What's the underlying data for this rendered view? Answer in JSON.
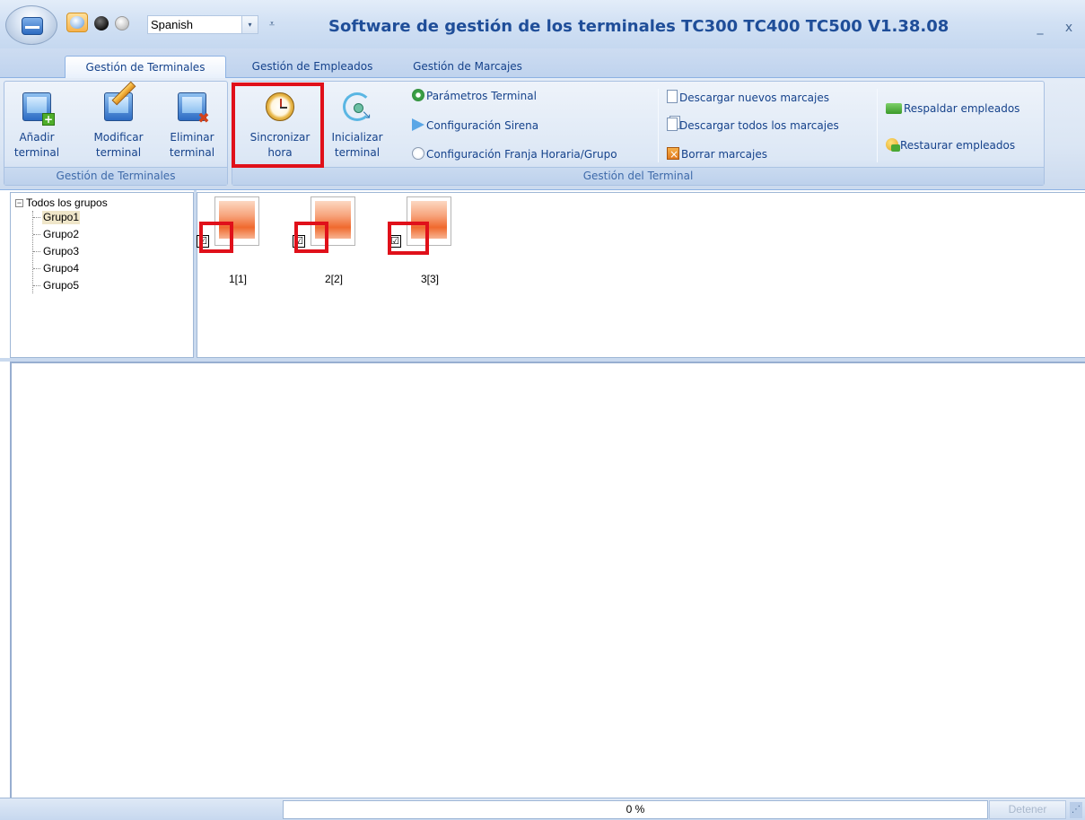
{
  "window": {
    "title": "Software de gestión de los terminales TC300 TC400 TC500 V1.38.08",
    "minimize_label": "_",
    "close_label": "x"
  },
  "quick_access": {
    "language": "Spanish",
    "dropdown_icon": "chevron-down-icon",
    "customize_icon": "customize-toolbar-icon"
  },
  "tabs": [
    {
      "label": "Gestión de Terminales",
      "active": true
    },
    {
      "label": "Gestión de Empleados",
      "active": false
    },
    {
      "label": "Gestión de Marcajes",
      "active": false
    }
  ],
  "ribbon": {
    "group_terminales": {
      "caption": "Gestión de Terminales",
      "buttons": [
        {
          "label": "Añadir\nterminal",
          "icon": "add-terminal-icon"
        },
        {
          "label": "Modificar\nterminal",
          "icon": "edit-terminal-icon"
        },
        {
          "label": "Eliminar\nterminal",
          "icon": "delete-terminal-icon"
        }
      ]
    },
    "group_terminal": {
      "caption": "Gestión del Terminal",
      "big_buttons": [
        {
          "label": "Sincronizar\nhora",
          "icon": "clock-icon",
          "highlighted": true
        },
        {
          "label": "Inicializar\nterminal",
          "icon": "reset-icon"
        }
      ],
      "small_buttons_col1": [
        {
          "label": "Parámetros Terminal",
          "icon": "gear-icon"
        },
        {
          "label": "Configuración Sirena",
          "icon": "siren-icon"
        },
        {
          "label": "Configuración Franja Horaria/Grupo",
          "icon": "clock-small-icon"
        }
      ],
      "small_buttons_col2": [
        {
          "label": "Descargar nuevos marcajes",
          "icon": "page-icon"
        },
        {
          "label": "Descargar todos los marcajes",
          "icon": "pages-icon"
        },
        {
          "label": "Borrar marcajes",
          "icon": "eraser-icon"
        }
      ],
      "small_buttons_col3": [
        {
          "label": "Respaldar empleados",
          "icon": "backup-icon"
        },
        {
          "label": "Restaurar empleados",
          "icon": "restore-icon"
        }
      ]
    }
  },
  "tree": {
    "root_label": "Todos los grupos",
    "expander": "⊟",
    "groups": [
      {
        "label": "Grupo1",
        "selected": true
      },
      {
        "label": "Grupo2",
        "selected": false
      },
      {
        "label": "Grupo3",
        "selected": false
      },
      {
        "label": "Grupo4",
        "selected": false
      },
      {
        "label": "Grupo5",
        "selected": false
      }
    ]
  },
  "terminals": [
    {
      "label": "1[1]",
      "checked": true,
      "check_glyph": "☑"
    },
    {
      "label": "2[2]",
      "checked": true,
      "check_glyph": "☑"
    },
    {
      "label": "3[3]",
      "checked": true,
      "check_glyph": "☑"
    }
  ],
  "status": {
    "progress_text": "0 %",
    "progress_value": 0,
    "stop_label": "Detener"
  },
  "colors": {
    "highlight": "#e0101a",
    "title_text": "#1f4e99",
    "ribbon_text": "#15428b"
  }
}
